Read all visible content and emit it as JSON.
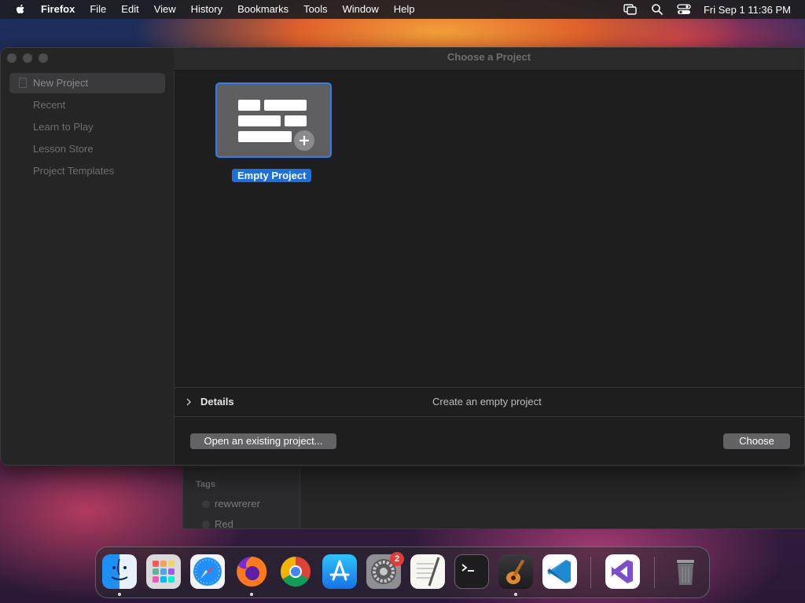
{
  "menubar": {
    "app_name": "Firefox",
    "items": [
      "File",
      "Edit",
      "View",
      "History",
      "Bookmarks",
      "Tools",
      "Window",
      "Help"
    ],
    "clock": "Fri Sep 1  11:36 PM",
    "icons": [
      "apple-icon",
      "screen-mirroring-icon",
      "spotlight-search-icon",
      "control-center-icon"
    ]
  },
  "dialog": {
    "title": "Choose a Project",
    "sidebar": {
      "items": [
        {
          "label": "New Project",
          "selected": true
        },
        {
          "label": "Recent"
        },
        {
          "label": "Learn to Play"
        },
        {
          "label": "Lesson Store"
        },
        {
          "label": "Project Templates"
        }
      ]
    },
    "template": {
      "label": "Empty Project",
      "icon": "empty-project-bricks-icon"
    },
    "details": {
      "label": "Details",
      "description": "Create an empty project"
    },
    "footer": {
      "open_label": "Open an existing project...",
      "choose_label": "Choose"
    }
  },
  "background_window": {
    "tags_title": "Tags",
    "tags": [
      "rewwrerer",
      "Red"
    ]
  },
  "dock": {
    "apps": [
      "Finder",
      "Launchpad",
      "Safari",
      "Firefox",
      "Google Chrome",
      "App Store",
      "System Settings",
      "TextEdit",
      "Terminal",
      "GarageBand",
      "Visual Studio Code",
      "Visual Studio",
      "Trash"
    ],
    "system_settings_badge": "2"
  },
  "colors": {
    "accent": "#1b6fe0",
    "selection_border": "#2f7fe8",
    "badge": "#e53b35"
  }
}
